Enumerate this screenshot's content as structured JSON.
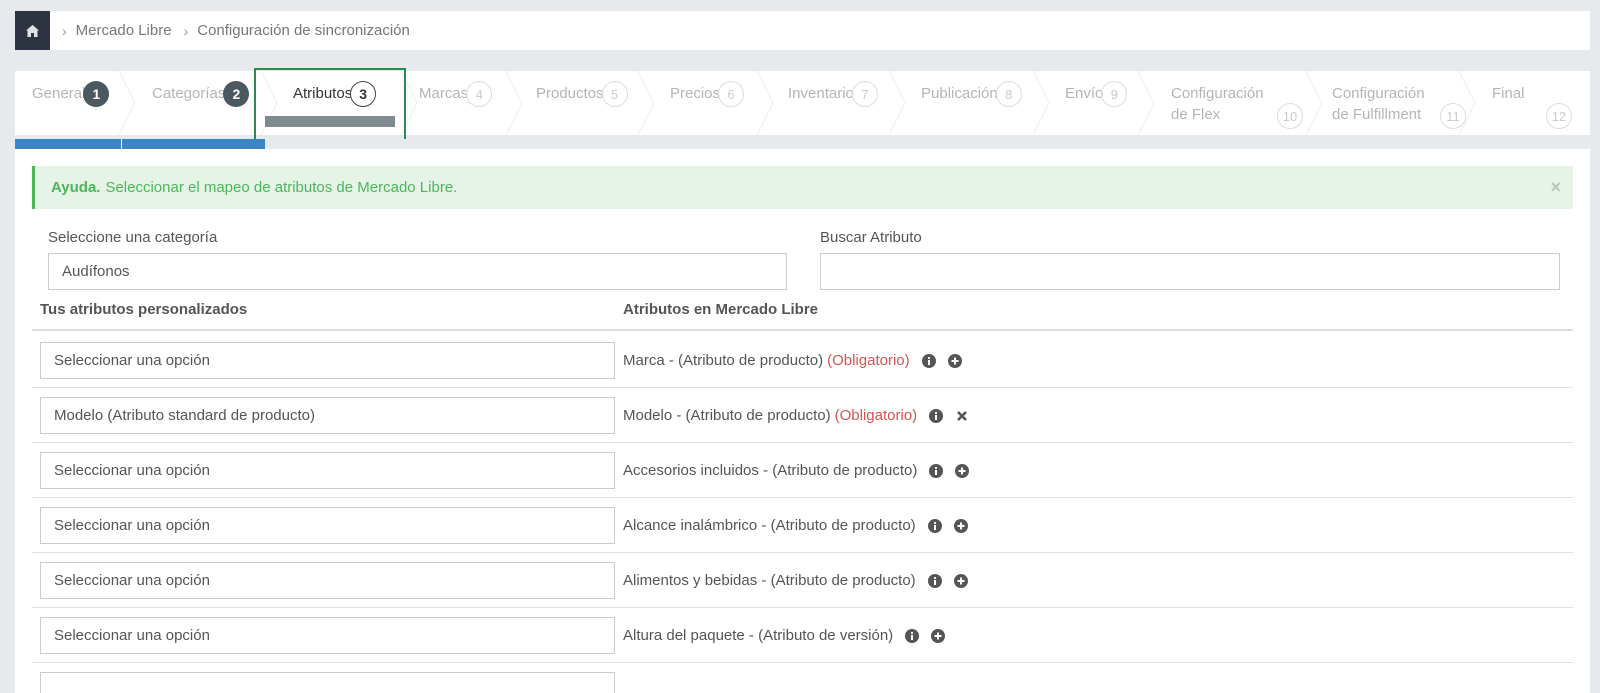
{
  "breadcrumb": {
    "home_icon": "home-icon",
    "items": [
      "Mercado Libre",
      "Configuración de sincronización"
    ]
  },
  "steps": [
    {
      "label": "General",
      "num": "1",
      "state": "done"
    },
    {
      "label": "Categorías",
      "num": "2",
      "state": "done"
    },
    {
      "label": "Atributos",
      "num": "3",
      "state": "current"
    },
    {
      "label": "Marcas",
      "num": "4",
      "state": "todo"
    },
    {
      "label": "Productos",
      "num": "5",
      "state": "todo"
    },
    {
      "label": "Precios",
      "num": "6",
      "state": "todo"
    },
    {
      "label": "Inventario",
      "num": "7",
      "state": "todo"
    },
    {
      "label": "Publicación",
      "num": "8",
      "state": "todo"
    },
    {
      "label": "Envío",
      "num": "9",
      "state": "todo"
    },
    {
      "label": "Configuración",
      "label2": "de Flex",
      "num": "10",
      "state": "todo"
    },
    {
      "label": "Configuración",
      "label2": "de Fulfillment",
      "num": "11",
      "state": "todo"
    },
    {
      "label": "Final",
      "num": "12",
      "state": "todo"
    }
  ],
  "alert": {
    "title": "Ayuda.",
    "text": "Seleccionar el mapeo de atributos de Mercado Libre.",
    "close": "×"
  },
  "category": {
    "label": "Seleccione una categoría",
    "value": "Audífonos"
  },
  "search": {
    "label": "Buscar Atributo",
    "value": ""
  },
  "table": {
    "col_custom": "Tus atributos personalizados",
    "col_ml": "Atributos en Mercado Libre",
    "rows": [
      {
        "select": "Seleccionar una opción",
        "name": "Marca",
        "type": "(Atributo de producto)",
        "required": "(Obligatorio)",
        "action": "plus"
      },
      {
        "select": "Modelo (Atributo standard de producto)",
        "name": "Modelo",
        "type": "(Atributo de producto)",
        "required": "(Obligatorio)",
        "action": "remove"
      },
      {
        "select": "Seleccionar una opción",
        "name": "Accesorios incluidos",
        "type": "(Atributo de producto)",
        "required": "",
        "action": "plus"
      },
      {
        "select": "Seleccionar una opción",
        "name": "Alcance inalámbrico",
        "type": "(Atributo de producto)",
        "required": "",
        "action": "plus"
      },
      {
        "select": "Seleccionar una opción",
        "name": "Alimentos y bebidas",
        "type": "(Atributo de producto)",
        "required": "",
        "action": "plus"
      },
      {
        "select": "Seleccionar una opción",
        "name": "Altura del paquete",
        "type": "(Atributo de versión)",
        "required": "",
        "action": "plus"
      }
    ]
  }
}
